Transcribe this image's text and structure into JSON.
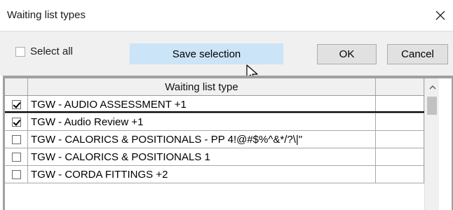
{
  "window": {
    "title": "Waiting list types",
    "close_icon": "close-icon"
  },
  "toolbar": {
    "select_all_label": "Select all",
    "select_all_checked": false,
    "save_label": "Save selection",
    "ok_label": "OK",
    "cancel_label": "Cancel"
  },
  "grid": {
    "column_header": "Waiting list type",
    "rows": [
      {
        "label": "TGW - AUDIO ASSESSMENT +1",
        "checked": true
      },
      {
        "label": "TGW - Audio Review +1",
        "checked": true
      },
      {
        "label": "TGW - CALORICS & POSITIONALS - PP 4!@#$%^&*/?\\|\"",
        "checked": false
      },
      {
        "label": "TGW - CALORICS & POSITIONALS 1",
        "checked": false
      },
      {
        "label": "TGW - CORDA FITTINGS +2",
        "checked": false
      }
    ]
  },
  "colors": {
    "toolbar_bg": "#f0f0f0",
    "save_button_bg": "#cce4f7",
    "button_bg": "#e1e1e1"
  }
}
